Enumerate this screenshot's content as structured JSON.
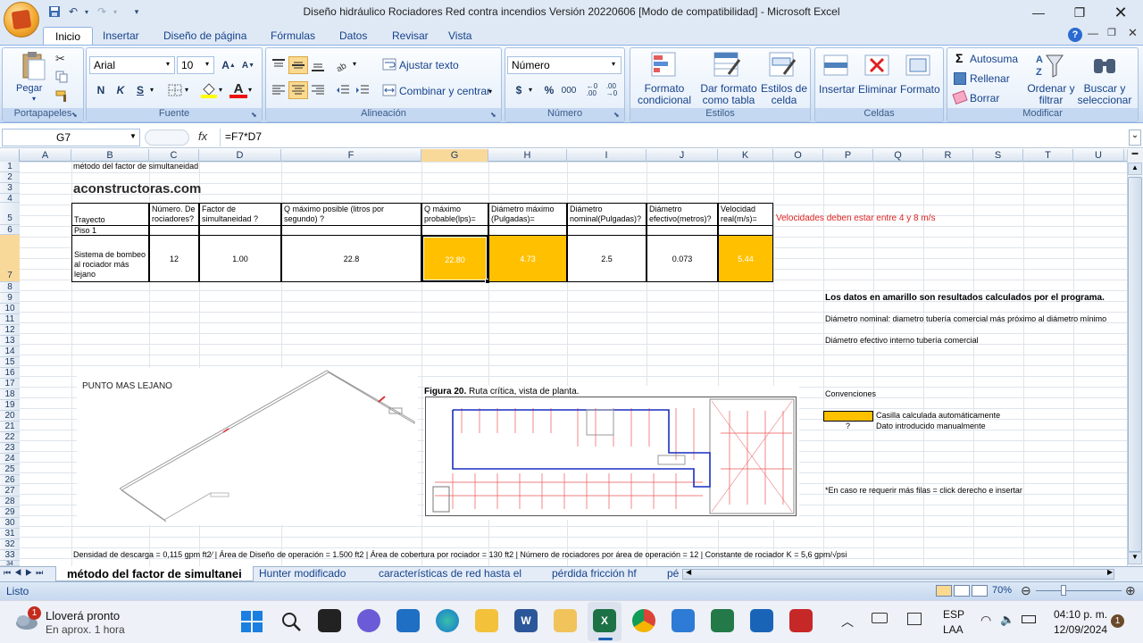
{
  "window": {
    "title": "Diseño hidráulico Rociadores Red contra incendios  Versión 20220606  [Modo de compatibilidad] - Microsoft Excel"
  },
  "ribbon": {
    "tabs": [
      "Inicio",
      "Insertar",
      "Diseño de página",
      "Fórmulas",
      "Datos",
      "Revisar",
      "Vista"
    ],
    "clipboard": {
      "paste": "Pegar",
      "label": "Portapapeles"
    },
    "font": {
      "name": "Arial",
      "size": "10",
      "bold": "N",
      "italic": "K",
      "underline": "S",
      "label": "Fuente"
    },
    "alignment": {
      "wrap": "Ajustar texto",
      "merge": "Combinar y centrar",
      "label": "Alineación"
    },
    "number": {
      "format": "Número",
      "label": "Número",
      "currency": "$",
      "percent": "%",
      "thousands": "000"
    },
    "styles": {
      "conditional": "Formato condicional",
      "table": "Dar formato como tabla",
      "cell": "Estilos de celda",
      "label": "Estilos"
    },
    "cells": {
      "insert": "Insertar",
      "delete": "Eliminar",
      "format": "Formato",
      "label": "Celdas"
    },
    "editing": {
      "autosum": "Autosuma",
      "fill": "Rellenar",
      "clear": "Borrar",
      "sort": "Ordenar y filtrar",
      "find": "Buscar y seleccionar",
      "label": "Modificar"
    }
  },
  "formula_bar": {
    "cell_ref": "G7",
    "fx": "fx",
    "formula": "=F7*D7"
  },
  "columns": [
    "A",
    "B",
    "C",
    "D",
    "F",
    "G",
    "H",
    "I",
    "J",
    "K",
    "O",
    "P",
    "Q",
    "R",
    "S",
    "T",
    "U"
  ],
  "rows": [
    "1",
    "2",
    "3",
    "4",
    "5",
    "6",
    "7",
    "8",
    "9",
    "10",
    "11",
    "12",
    "13",
    "14",
    "15",
    "16",
    "17",
    "18",
    "19",
    "20",
    "21",
    "22",
    "23",
    "24",
    "25",
    "26",
    "27",
    "28",
    "29",
    "30",
    "31",
    "32",
    "33",
    "34"
  ],
  "sheet": {
    "b1": "método del factor de simultaneidad",
    "logo": "aconstructoras.com",
    "headers": {
      "trayecto": "Trayecto",
      "numero": "Número. De rociadores?",
      "factor": "Factor de simultaneidad ?",
      "qmax": "Q máximo posible (litros por segundo) ?",
      "qprob": "Q máximo probable(lps)=",
      "dmax": "Diámetro máximo (Pulgadas)=",
      "dnom": "Diámetro nominal(Pulgadas)?",
      "defe": "Diámetro efectivo(metros)?",
      "vel": "Velocidad real(m/s)="
    },
    "warning": "Velocidades deben estar entre 4 y 8 m/s",
    "piso": "Piso 1",
    "row7": {
      "trayecto": "Sistema de bombeo al rociador más lejano",
      "numero": "12",
      "factor": "1.00",
      "qmax": "22.8",
      "qprob": "22.80",
      "dmax": "4.73",
      "dnom": "2.5",
      "defe": "0.073",
      "vel": "5.44"
    },
    "note1": "Los datos en amarillo son resultados calculados por el programa.",
    "note2": "Diámetro nominal: diametro tubería comercial más próximo al diámetro mínimo",
    "note3": "Diámetro efectivo interno tubería comercial",
    "punto": "PUNTO MAS LEJANO",
    "figura_bold": "Figura 20.",
    "figura_text": " Ruta crítica, vista de planta.",
    "convenciones": "Convenciones",
    "conv_auto": "Casilla calculada automáticamente",
    "conv_q": "?",
    "conv_manual": "Dato introducido manualmente",
    "insert_note": "*En caso re requerir más filas = click derecho e insertar",
    "footer": "Densidad de descarga = 0,115 gpm ft2⁄ | Área de Diseño de operación = 1.500 ft2 | Área de cobertura por rociador = 130 ft2 | Número de rociadores por área de operación = 12 | Constante de rociador K = 5,6 gpm/√psi"
  },
  "sheet_tabs": [
    "método del factor de simultanei",
    "Hunter modificado",
    "características de red hasta el",
    "pérdida fricción hf",
    "pé"
  ],
  "status": {
    "ready": "Listo",
    "zoom": "70%"
  },
  "taskbar": {
    "weather_title": "Lloverá pronto",
    "weather_sub": "En aprox. 1 hora",
    "badge": "1",
    "lang1": "ESP",
    "lang2": "LAA",
    "time": "04:10 p. m.",
    "date": "12/09/2024",
    "notif": "1"
  },
  "colors": {
    "accent": "#ffc000",
    "warning": "#e02020"
  }
}
